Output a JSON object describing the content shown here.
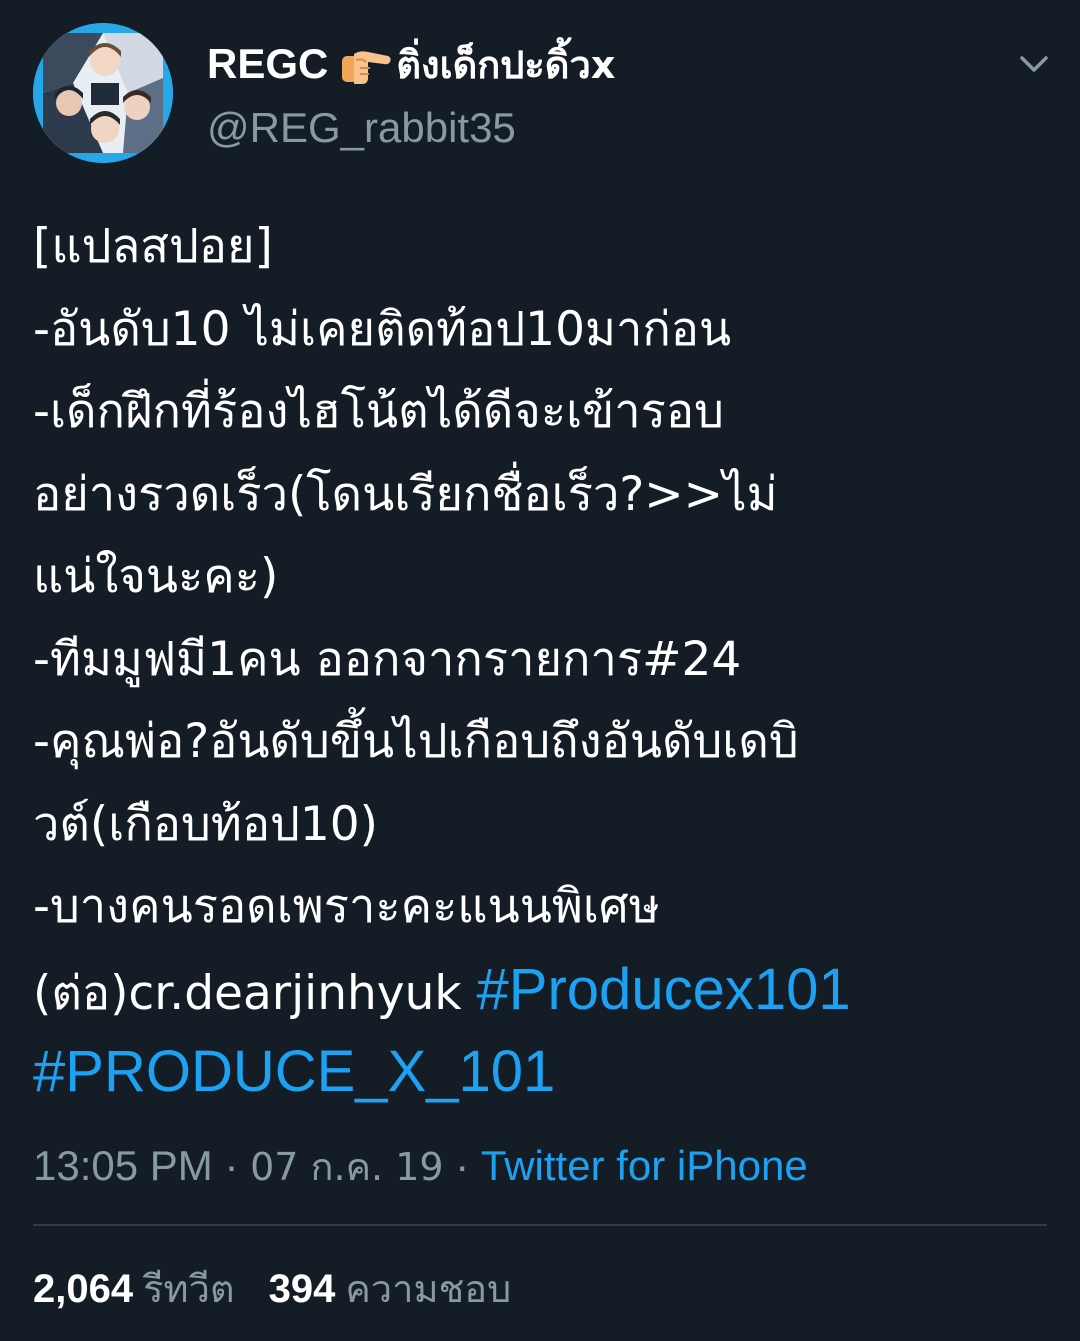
{
  "author": {
    "display_name": "REGC",
    "display_name_suffix": "ติ่งเด็กปะดิ้วx",
    "emoji": "backhand-index-pointing-right",
    "handle": "@REG_rabbit35"
  },
  "tweet": {
    "lines": [
      "[แปลสปอย]",
      "-อันดับ10 ไม่เคยติดท้อป10มาก่อน",
      "-เด็กฝึกที่ร้องไฮโน้ตได้ดีจะเข้ารอบ",
      "อย่างรวดเร็ว(โดนเรียกชื่อเร็ว?>>ไม่",
      "แน่ใจนะคะ)",
      "-ทีมมูฟมี1คน ออกจากรายการ#24",
      "-คุณพ่อ?อันดับขึ้นไปเกือบถึงอันดับเดบิ",
      "วต์(เกือบท้อป10)",
      "-บางคนรอดเพราะคะแนนพิเศษ"
    ],
    "credit_line": "(ต่อ)cr.dearjinhyuk ",
    "hashtag_1": "#Producex101",
    "hashtag_2": "#PRODUCE_X_101"
  },
  "meta": {
    "time": "13:05 PM",
    "separator": " · ",
    "date": "07 ก.ค. 19",
    "source": "Twitter for iPhone"
  },
  "stats": {
    "retweets_count": "2,064",
    "retweets_label": "รีทวีต",
    "likes_count": "394",
    "likes_label": "ความชอบ"
  },
  "colors": {
    "background": "#141d26",
    "link": "#1da1f2",
    "secondary_text": "#8899a6",
    "avatar_ring": "#25a7e8"
  }
}
